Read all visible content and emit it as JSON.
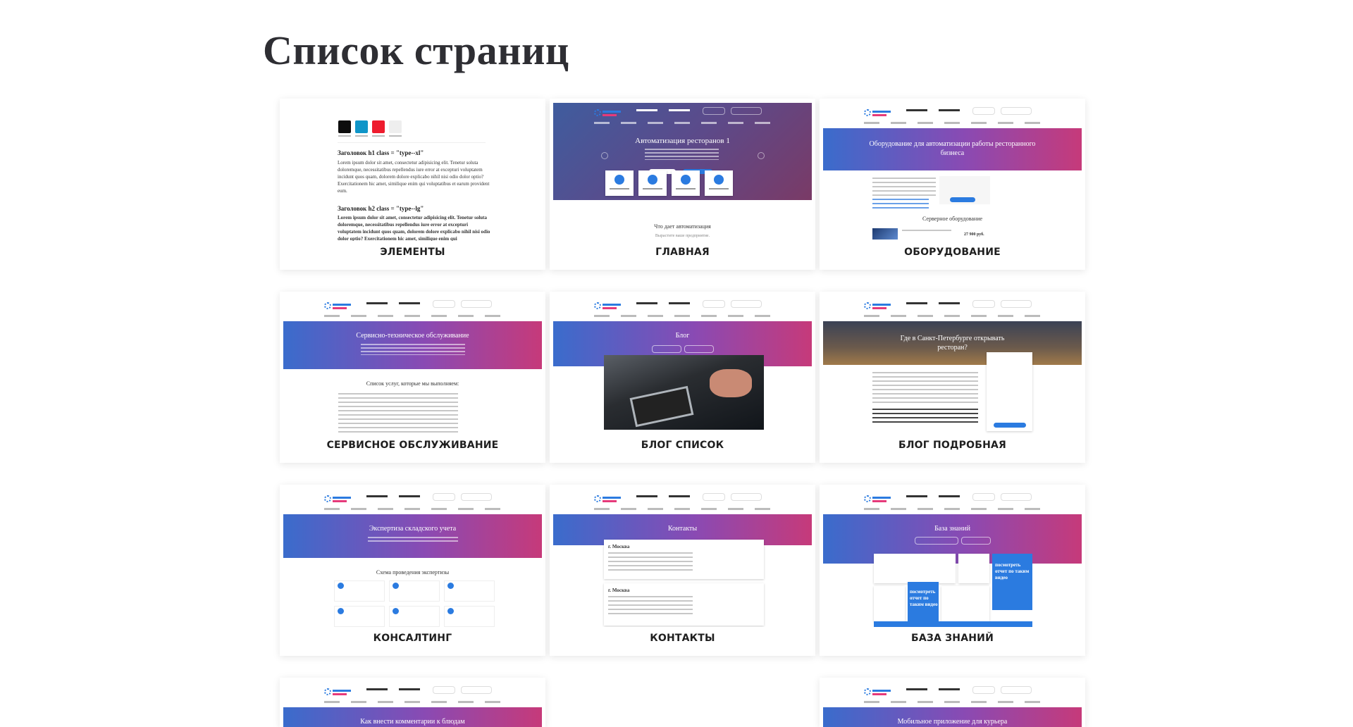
{
  "page": {
    "title": "Список страниц"
  },
  "cards": [
    {
      "label": "ЭЛЕМЕНТЫ",
      "heading1": "Заголовок h1 class = \"type--xl\"",
      "paragraph1": "Lorem ipsum dolor sit amet, consectetur adipisicing elit. Tenetur soluta doloremque, necessitatibus repellendus iure error at excepturi voluptatem incidunt quos quam, dolorem dolore explicabo nihil nisi odio dolor optio? Exercitationem hic amet, similique enim qui voluptatibus et earum provident eum.",
      "heading2": "Заголовок h2 class = \"type--lg\"",
      "paragraph2": "Lorem ipsum dolor sit amet, consectetur adipisicing elit. Tenetur soluta doloremque, necessitatibus repellendus iure error at excepturi voluptatem incidunt quos quam, dolorem dolore explicabo nihil nisi odio dolor optio? Exercitationem hic amet, similique enim qui",
      "swatch_colors": [
        "#0d0d0d",
        "#0f95c8",
        "#ee1c2e",
        "#eeeeee"
      ]
    },
    {
      "label": "ГЛАВНАЯ",
      "hero_title": "Автоматизация ресторанов 1",
      "section_title": "Что дает автоматизация",
      "section_sub": "Вырастите ваше предприятие."
    },
    {
      "label": "ОБОРУДОВАНИЕ",
      "hero_title": "Оборудование для автоматизации работы ресторанного бизнеса",
      "section_title": "Серверное оборудование",
      "price": "27 900 руб."
    },
    {
      "label": "СЕРВИСНОЕ ОБСЛУЖИВАНИЕ",
      "hero_title": "Сервисно-техническое обслуживание",
      "section_title": "Список услуг, которые мы выполняем:"
    },
    {
      "label": "БЛОГ СПИСОК",
      "hero_title": "Блог"
    },
    {
      "label": "БЛОГ ПОДРОБНАЯ",
      "hero_title": "Где в Санкт-Петербурге открывать ресторан?"
    },
    {
      "label": "КОНСАЛТИНГ",
      "hero_title": "Экспертиза складского учета",
      "section_title": "Схема проведения экспертизы"
    },
    {
      "label": "КОНТАКТЫ",
      "hero_title": "Контакты",
      "city1": "г. Москва",
      "city2": "г. Москва"
    },
    {
      "label": "БАЗА ЗНАНИЙ",
      "hero_title": "База знаний",
      "promo_text": "посмотреть отчет по таким видео"
    },
    {
      "label": "",
      "hero_title": "Как внести комментарии к блюдам"
    },
    {
      "label": "",
      "hero_title": "Мобильное приложение для курьера"
    }
  ]
}
